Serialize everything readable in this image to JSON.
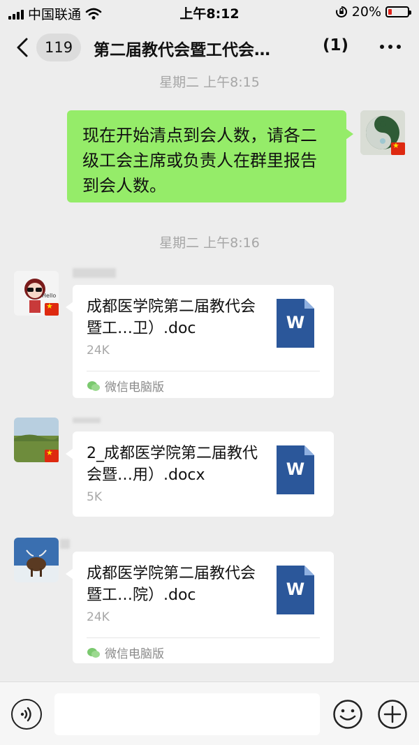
{
  "status_bar": {
    "carrier": "中国联通",
    "time": "上午8:12",
    "battery": "20%",
    "battery_level": 0.2
  },
  "nav": {
    "unread_count": "119",
    "title": "第二届教代会暨工代会…",
    "member_badge": "(1)"
  },
  "messages": {
    "t1": "星期二 上午8:15",
    "outgoing_text": "现在开始清点到会人数，请各二级工会主席或负责人在群里报告到会人数。",
    "t2": "星期二 上午8:16",
    "files": [
      {
        "name": "成都医学院第二届教代会暨工…卫）.doc",
        "size": "24K",
        "icon_label": "W",
        "source": "微信电脑版"
      },
      {
        "name": "2_成都医学院第二届教代会暨…用）.docx",
        "size": "5K",
        "icon_label": "W",
        "source": ""
      },
      {
        "name": "成都医学院第二届教代会暨工…院）.doc",
        "size": "24K",
        "icon_label": "W",
        "source": "微信电脑版"
      }
    ]
  },
  "colors": {
    "outgoing_bubble": "#95ec69",
    "word_blue": "#2b579a",
    "background": "#ededed"
  }
}
